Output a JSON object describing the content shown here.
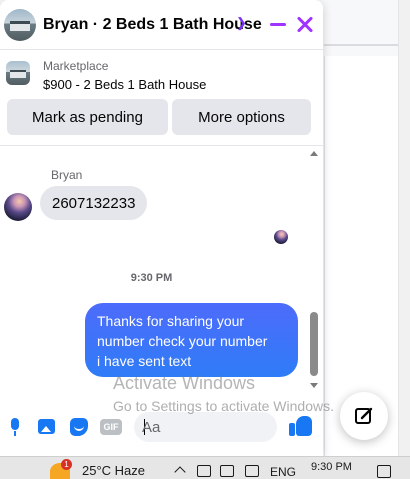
{
  "header": {
    "title": "Bryan · 2 Beds 1 Bath House",
    "chevron_icon": "chevron-down-icon",
    "minimize_icon": "minimize-icon",
    "close_icon": "close-icon",
    "accent_color": "#a033ff"
  },
  "marketplace": {
    "label": "Marketplace",
    "listing": "$900 - 2 Beds 1 Bath House",
    "buttons": {
      "mark_pending": "Mark as pending",
      "more_options": "More options"
    }
  },
  "conversation": {
    "sender_name": "Bryan",
    "incoming": [
      {
        "text": "2607132233"
      }
    ],
    "time_separator": "9:30 PM",
    "outgoing": [
      {
        "lines": [
          "Thanks for sharing your",
          "number check your number",
          "i have sent text"
        ]
      }
    ],
    "outgoing_color": "#2f6cf7"
  },
  "watermark": {
    "title": "Activate Windows",
    "subtitle": "Go to Settings to activate Windows."
  },
  "composer": {
    "placeholder": "Aa",
    "value": "",
    "icons": [
      "microphone-icon",
      "photo-icon",
      "sticker-icon",
      "gif-icon",
      "emoji-icon",
      "thumbs-up-icon"
    ],
    "gif_label": "GIF",
    "accent_color": "#1877f2"
  },
  "fab": {
    "icon": "compose-icon"
  },
  "taskbar": {
    "weather_badge": "1",
    "weather": "25°C  Haze",
    "language": "ENG",
    "time": "9:30 PM"
  }
}
